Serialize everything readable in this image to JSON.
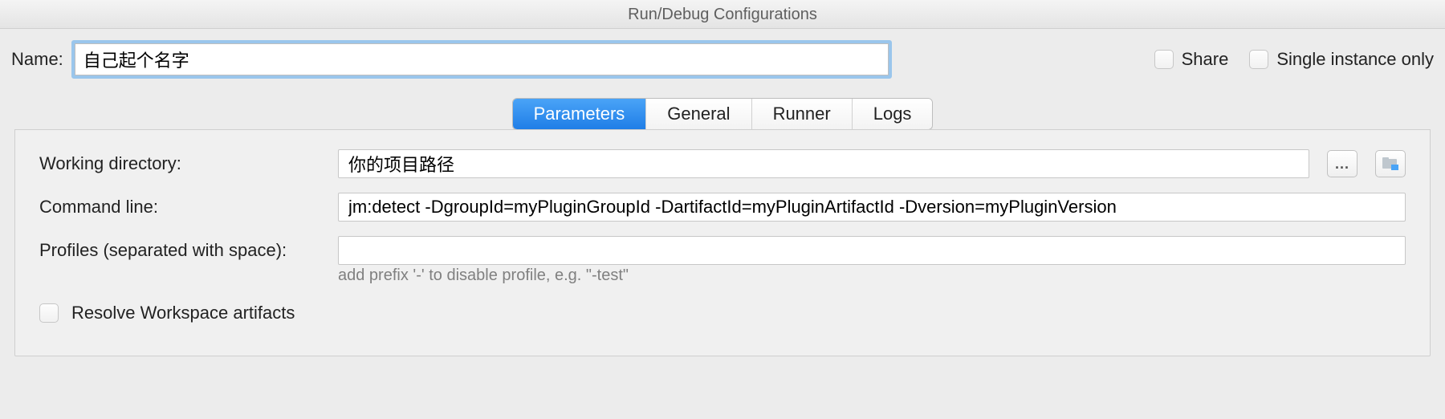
{
  "window": {
    "title": "Run/Debug Configurations"
  },
  "name": {
    "label": "Name:",
    "value": "自己起个名字"
  },
  "share": {
    "label": "Share"
  },
  "single_instance": {
    "label": "Single instance only"
  },
  "tabs": {
    "items": [
      {
        "label": "Parameters"
      },
      {
        "label": "General"
      },
      {
        "label": "Runner"
      },
      {
        "label": "Logs"
      }
    ]
  },
  "working_dir": {
    "label": "Working directory:",
    "value": "你的项目路径",
    "browse_label": "..."
  },
  "command_line": {
    "label": "Command line:",
    "value": "jm:detect -DgroupId=myPluginGroupId -DartifactId=myPluginArtifactId -Dversion=myPluginVersion"
  },
  "profiles": {
    "label": "Profiles (separated with space):",
    "value": "",
    "hint": "add prefix '-' to disable profile, e.g. \"-test\""
  },
  "resolve_workspace": {
    "label": "Resolve Workspace artifacts"
  }
}
